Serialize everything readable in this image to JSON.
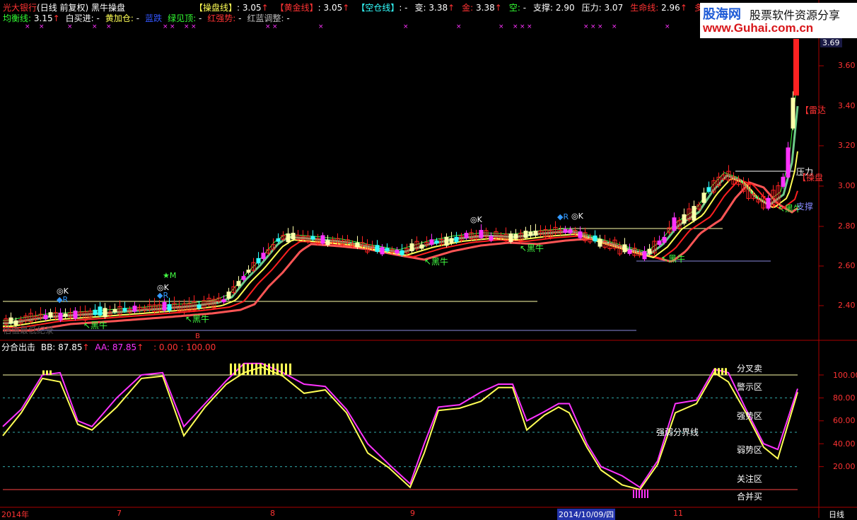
{
  "header": {
    "stock": "光大银行",
    "mode": "(日线 前复权)",
    "indicator": "黑牛操盘",
    "row1": [
      {
        "label": "【操盘线】",
        "value": ": 3.05",
        "arrow": "↑",
        "color": "#ffff55"
      },
      {
        "label": "【黄金线】",
        "value": ": 3.05",
        "arrow": "↑",
        "color": "#ff3333"
      },
      {
        "label": "【空仓线】",
        "value": ": -",
        "arrow": "",
        "color": "#33ffff"
      },
      {
        "label": "变:",
        "value": " 3.38",
        "arrow": "↑",
        "color": "#ffffff"
      },
      {
        "label": "金:",
        "value": " 3.38",
        "arrow": "↑",
        "color": "#ff3333"
      },
      {
        "label": "空:",
        "value": " -",
        "arrow": "",
        "color": "#33ff33"
      },
      {
        "label": "支撑:",
        "value": " 2.90",
        "arrow": "",
        "color": "#ffffff"
      },
      {
        "label": "压力:",
        "value": " 3.07",
        "arrow": "",
        "color": "#ffffff"
      },
      {
        "label": "生命线:",
        "value": " 2.96",
        "arrow": "↑",
        "color": "#ff3333"
      },
      {
        "label": "多头线",
        "value": "",
        "arrow": "",
        "color": "#ff3333"
      }
    ],
    "row2": [
      {
        "label": "均衡线:",
        "value": " 3.15",
        "arrow": "↑",
        "color": "#33ff33"
      },
      {
        "label": "白买进:",
        "value": " -",
        "arrow": "",
        "color": "#ffffff"
      },
      {
        "label": "黄加仓:",
        "value": " -",
        "arrow": "",
        "color": "#ffff55"
      },
      {
        "label": "蓝跌",
        "value": "",
        "arrow": "",
        "color": "#3355ff"
      },
      {
        "label": "绿见顶:",
        "value": " -",
        "arrow": "",
        "color": "#33ff33"
      },
      {
        "label": "红强势:",
        "value": " -",
        "arrow": "",
        "color": "#ff3333"
      },
      {
        "label": "红蓝调整:",
        "value": " -",
        "arrow": "",
        "color": "#bbbbbb"
      }
    ]
  },
  "logo": {
    "cn": "股海网",
    "cn2": "股票软件资源分享",
    "url": "www.Guhai.com.cn"
  },
  "price_axis": {
    "current": "3.69",
    "ticks": [
      "3.60",
      "3.40",
      "3.20",
      "3.00",
      "2.80",
      "2.60",
      "2.40"
    ]
  },
  "chart_labels": {
    "heiniu": "↖黑牛",
    "leida": "【雷达",
    "yali": "压力",
    "caopan": "【操盘",
    "zhicheng": "支撑",
    "ok": "◎K",
    "r": "◆R",
    "m": "★M",
    "watermark": "估值最低纪录",
    "b": "B"
  },
  "sub_header": {
    "name": "分合出击",
    "bb": "BB: 87.85",
    "aa": "AA: 87.85",
    "extra": ": 0.00 : 100.00"
  },
  "sub_axis": {
    "ticks": [
      "100.00",
      "80.00",
      "60.00",
      "40.00",
      "20.00"
    ]
  },
  "zones": [
    "分叉卖",
    "警示区",
    "强势区",
    "强弱分界线",
    "弱势区",
    "关注区",
    "合并买"
  ],
  "date_axis": {
    "labels": [
      "2014年",
      "7",
      "8",
      "9",
      "2014/10/09/四",
      "11"
    ],
    "period": "日线"
  },
  "colors": {
    "up": "#ff2222",
    "down": "#33ffff",
    "ma_red": "#ff2020",
    "ma_yellow": "#ffff55",
    "ma_green": "#44ff44",
    "magenta": "#ff33ff",
    "grid": "#aa0000"
  }
}
